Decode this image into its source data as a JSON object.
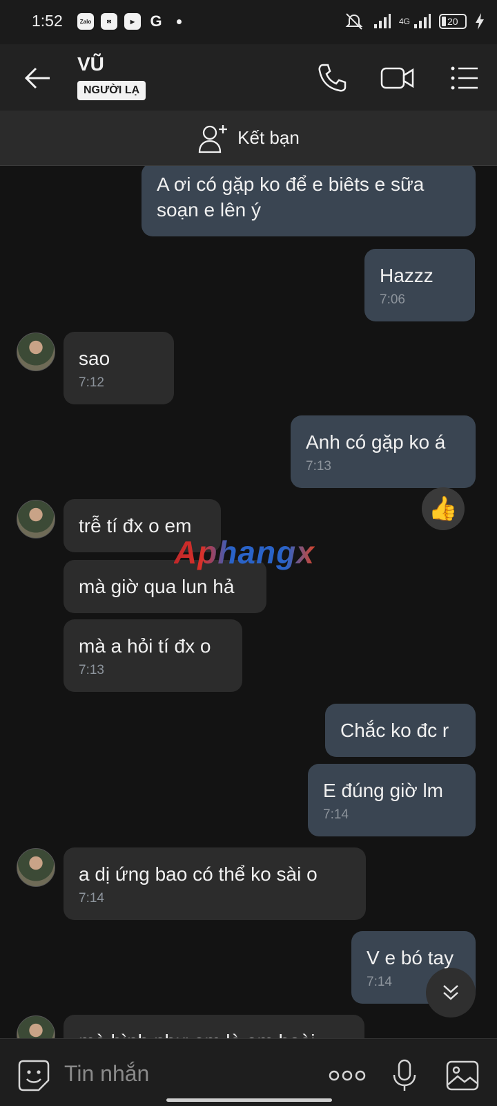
{
  "status_bar": {
    "time": "1:52",
    "app_icons": [
      "Zalo",
      "Zalo",
      "▶",
      "G"
    ],
    "network": "4G",
    "battery": "20"
  },
  "header": {
    "contact_name": "VŨ",
    "badge": "NGƯỜI LẠ"
  },
  "friend_bar": {
    "label": "Kết bạn"
  },
  "messages": [
    {
      "dir": "out",
      "text": "A ơi có gặp ko để e biêts e sữa soạn e lên ý",
      "time": ""
    },
    {
      "dir": "out",
      "text": "Hazzz",
      "time": "7:06"
    },
    {
      "dir": "in",
      "text": "sao",
      "time": "7:12"
    },
    {
      "dir": "out",
      "text": "Anh có gặp ko á",
      "time": "7:13"
    },
    {
      "dir": "in",
      "text": "trễ tí đx o em",
      "time": ""
    },
    {
      "dir": "in",
      "text": "mà giờ qua lun hả",
      "time": ""
    },
    {
      "dir": "in",
      "text": "mà a hỏi tí đx o",
      "time": "7:13"
    },
    {
      "dir": "out",
      "text": "Chắc ko đc r",
      "time": ""
    },
    {
      "dir": "out",
      "text": "E đúng giờ lm",
      "time": "7:14"
    },
    {
      "dir": "in",
      "text": "a dị ứng bao có thể ko sài  o",
      "time": "7:14"
    },
    {
      "dir": "out",
      "text": "V e bó tay",
      "time": "7:14"
    },
    {
      "dir": "in",
      "text": "mà bình như em là em hoài",
      "time": ""
    }
  ],
  "reaction": "👍",
  "watermark": "Aphangx",
  "input": {
    "placeholder": "Tin nhắn"
  }
}
